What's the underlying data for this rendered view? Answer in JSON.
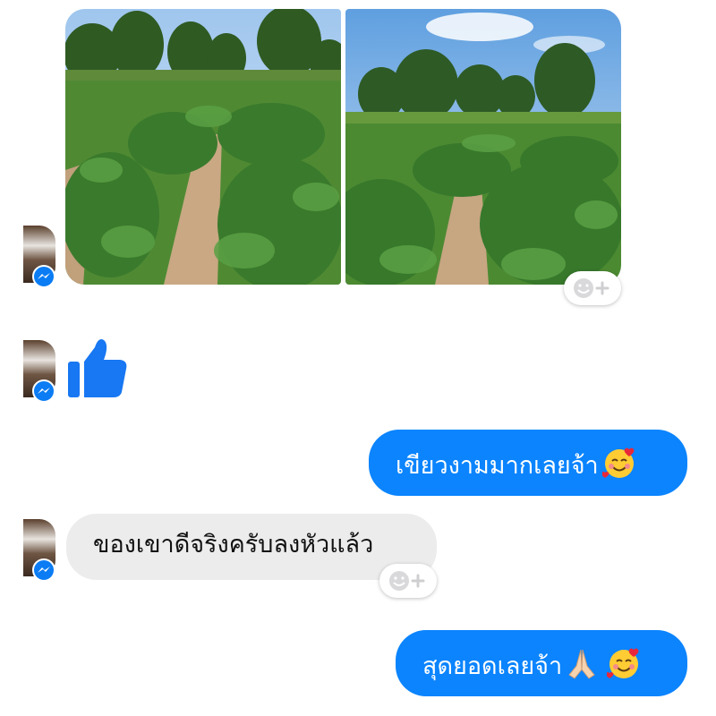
{
  "messages": [
    {
      "sender": "contact",
      "type": "photos",
      "count": 2,
      "reaction_button": "add-reaction"
    },
    {
      "sender": "contact",
      "type": "sticker",
      "sticker": "thumbs-up-like"
    },
    {
      "sender": "me",
      "type": "text",
      "text": "เขียวงามมากเลยจ้า",
      "emoji": [
        "smiling-face-with-hearts"
      ]
    },
    {
      "sender": "contact",
      "type": "text",
      "text": "ของเขาดีจริงครับลงหัวแล้ว",
      "reaction_button": "add-reaction"
    },
    {
      "sender": "me",
      "type": "text",
      "text": "สุดยอดเลยจ้า",
      "emoji": [
        "folded-hands",
        "smiling-face-with-hearts"
      ]
    }
  ],
  "colors": {
    "outgoing_bubble": "#0b84fe",
    "incoming_bubble": "#ececed",
    "like_icon": "#1877f2",
    "messenger_badge": "#0b7cf4"
  }
}
